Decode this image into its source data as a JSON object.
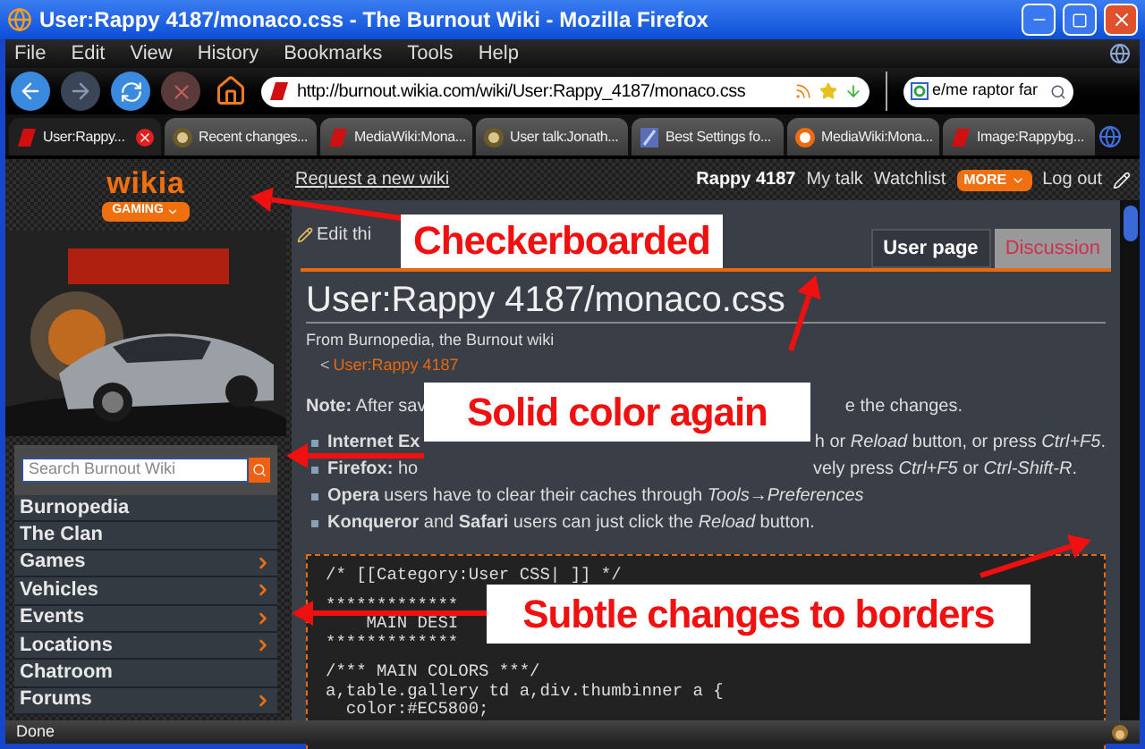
{
  "window": {
    "title": "User:Rappy 4187/monaco.css - The Burnout Wiki - Mozilla Firefox"
  },
  "menu": [
    "File",
    "Edit",
    "View",
    "History",
    "Bookmarks",
    "Tools",
    "Help"
  ],
  "address_bar": {
    "value": "http://burnout.wikia.com/wiki/User:Rappy_4187/monaco.css"
  },
  "search_bar": {
    "value": "e/me raptor far"
  },
  "tabs": [
    {
      "label": "User:Rappy...",
      "selected": true,
      "kind": "burnout"
    },
    {
      "label": "Recent changes...",
      "selected": false,
      "kind": "emblem"
    },
    {
      "label": "MediaWiki:Mona...",
      "selected": false,
      "kind": "burnout"
    },
    {
      "label": "User talk:Jonath...",
      "selected": false,
      "kind": "emblem"
    },
    {
      "label": "Best Settings fo...",
      "selected": false,
      "kind": "page"
    },
    {
      "label": "MediaWiki:Mona...",
      "selected": false,
      "kind": "wikia"
    },
    {
      "label": "Image:Rappybg...",
      "selected": false,
      "kind": "burnout"
    }
  ],
  "wiki_header": {
    "logo": "wikia",
    "badge": "GAMING",
    "request_link": "Request a new wiki",
    "user": "Rappy 4187",
    "links": [
      "My talk",
      "Watchlist"
    ],
    "more": "MORE",
    "logout": "Log out"
  },
  "sidebar": {
    "search_placeholder": "Search Burnout Wiki",
    "items": [
      {
        "label": "Burnopedia",
        "expandable": false
      },
      {
        "label": "The Clan",
        "expandable": false
      },
      {
        "label": "Games",
        "expandable": true
      },
      {
        "label": "Vehicles",
        "expandable": true
      },
      {
        "label": "Events",
        "expandable": true
      },
      {
        "label": "Locations",
        "expandable": true
      },
      {
        "label": "Chatroom",
        "expandable": false
      },
      {
        "label": "Forums",
        "expandable": true
      }
    ]
  },
  "page_actions": [
    "Edit thi"
  ],
  "page_tabs": [
    {
      "label": "User page",
      "selected": true
    },
    {
      "label": "Discussion",
      "selected": false
    }
  ],
  "article": {
    "title": "User:Rappy 4187/monaco.css",
    "subtitle": "From Burnopedia, the Burnout wiki",
    "breadcrumb_arrow": "<",
    "breadcrumb": "User:Rappy 4187",
    "note": [
      "**Note:** After sav",
      "e the changes."
    ],
    "bullets": [
      {
        "left": "**Internet Ex**",
        "right": "h or *Reload* button, or press *Ctrl+F5*."
      },
      {
        "left": "**Firefox:** ho",
        "right": "vely press *Ctrl+F5* or *Ctrl-Shift-R*."
      },
      {
        "left": "**Opera** users have to clear their caches through *Tools→Preferences*"
      },
      {
        "left": "**Konqueror** and **Safari** users can just click the *Reload* button."
      }
    ],
    "code": [
      [
        "/* [[Category:User CSS| ]] */"
      ],
      [
        "*************",
        "    MAIN DESI",
        "*************"
      ],
      [
        "/*** MAIN COLORS ***/",
        "a,table.gallery td a,div.thumbinner a {",
        "  color:#EC5800;"
      ]
    ]
  },
  "annotations": [
    {
      "text": "Checkerboarded"
    },
    {
      "text": "Solid color again"
    },
    {
      "text": "Subtle changes to borders"
    }
  ],
  "status_bar": {
    "text": "Done"
  }
}
